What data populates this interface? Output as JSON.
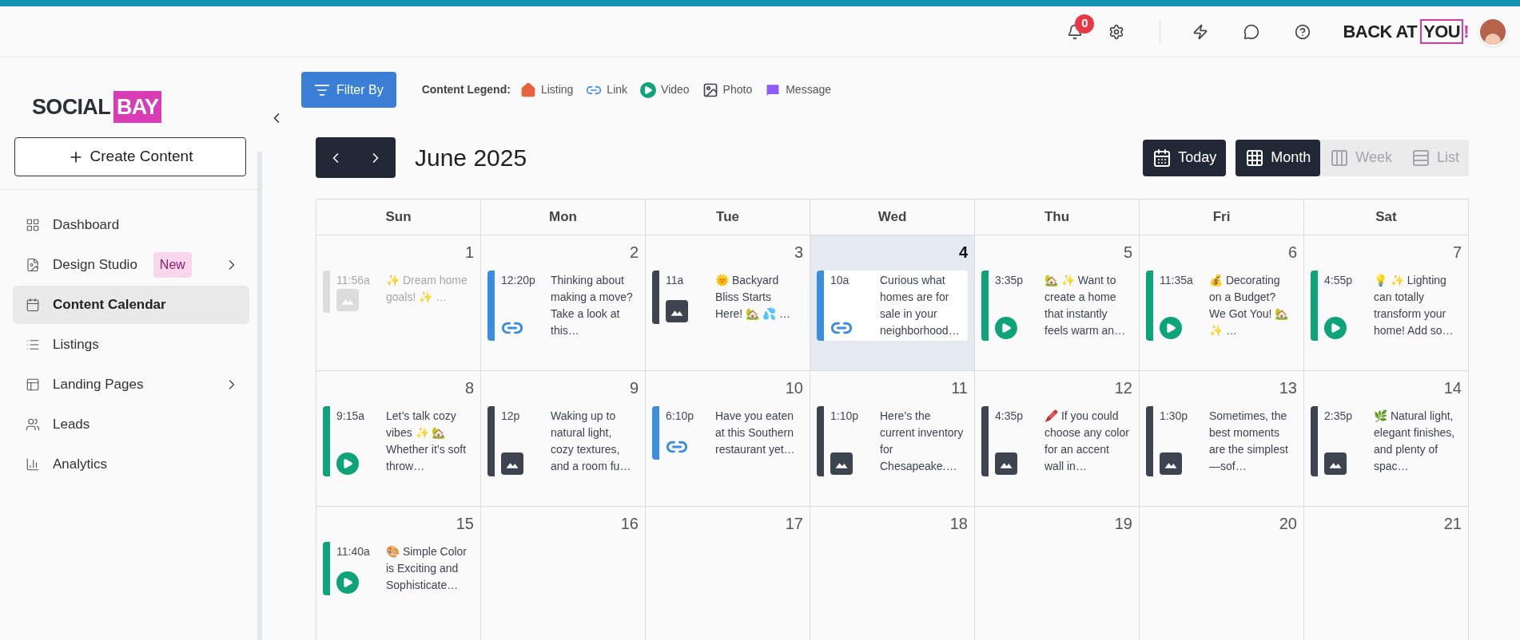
{
  "header": {
    "notification_count": "0",
    "brand": {
      "left": "BACK AT",
      "right": "YOU",
      "mark": "!"
    }
  },
  "sidebar": {
    "logo": {
      "left": "SOCIAL",
      "right": "BAY"
    },
    "create_button": "Create Content",
    "items": [
      {
        "label": "Dashboard",
        "kind": "dashboard",
        "selected": false,
        "submenu": false
      },
      {
        "label": "Design Studio",
        "kind": "design",
        "selected": false,
        "submenu": true,
        "badge": "New"
      },
      {
        "label": "Content Calendar",
        "kind": "calendar",
        "selected": true,
        "submenu": false
      },
      {
        "label": "Listings",
        "kind": "listings",
        "selected": false,
        "submenu": false
      },
      {
        "label": "Landing Pages",
        "kind": "landing",
        "selected": false,
        "submenu": true
      },
      {
        "label": "Leads",
        "kind": "leads",
        "selected": false,
        "submenu": false
      },
      {
        "label": "Analytics",
        "kind": "analytics",
        "selected": false,
        "submenu": false
      }
    ]
  },
  "filter_button": "Filter By",
  "legend": {
    "title": "Content Legend:",
    "items": [
      {
        "label": "Listing",
        "kind": "listing"
      },
      {
        "label": "Link",
        "kind": "link"
      },
      {
        "label": "Video",
        "kind": "video"
      },
      {
        "label": "Photo",
        "kind": "photo"
      },
      {
        "label": "Message",
        "kind": "message"
      }
    ]
  },
  "calendar": {
    "title": "June 2025",
    "today_button": "Today",
    "views": [
      {
        "label": "Month",
        "kind": "month",
        "selected": true
      },
      {
        "label": "Week",
        "kind": "week",
        "selected": false
      },
      {
        "label": "List",
        "kind": "list",
        "selected": false
      }
    ],
    "weekdays": [
      "Sun",
      "Mon",
      "Tue",
      "Wed",
      "Thu",
      "Fri",
      "Sat"
    ],
    "days": [
      {
        "number": "1",
        "today": false,
        "events": [
          {
            "time": "11:56a",
            "text": "✨ Dream home goals! ✨ …",
            "kind": "photo",
            "faded": true
          }
        ]
      },
      {
        "number": "2",
        "today": false,
        "events": [
          {
            "time": "12:20p",
            "text": "Thinking about making a move? Take a look at this…",
            "kind": "link",
            "faded": false
          }
        ]
      },
      {
        "number": "3",
        "today": false,
        "events": [
          {
            "time": "11a",
            "text": "🌞 Backyard Bliss Starts Here! 🏡 💦 …",
            "kind": "photo",
            "faded": false
          }
        ]
      },
      {
        "number": "4",
        "today": true,
        "events": [
          {
            "time": "10a",
            "text": "Curious what homes are for sale in your neighborhood…",
            "kind": "link",
            "faded": false
          }
        ]
      },
      {
        "number": "5",
        "today": false,
        "events": [
          {
            "time": "3:35p",
            "text": "🏡 ✨ Want to create a home that instantly feels warm an…",
            "kind": "video",
            "faded": false
          }
        ]
      },
      {
        "number": "6",
        "today": false,
        "events": [
          {
            "time": "11:35a",
            "text": "💰 Decorating on a Budget? We Got You! 🏡 ✨ …",
            "kind": "video",
            "faded": false
          }
        ]
      },
      {
        "number": "7",
        "today": false,
        "events": [
          {
            "time": "4:55p",
            "text": "💡 ✨ Lighting can totally transform your home! Add so…",
            "kind": "video",
            "faded": false
          }
        ]
      },
      {
        "number": "8",
        "today": false,
        "events": [
          {
            "time": "9:15a",
            "text": "Let’s talk cozy vibes ✨ 🏡 Whether it’s soft throw…",
            "kind": "video",
            "faded": false
          }
        ]
      },
      {
        "number": "9",
        "today": false,
        "events": [
          {
            "time": "12p",
            "text": "Waking up to natural light, cozy textures, and a room fu…",
            "kind": "photo",
            "faded": false
          }
        ]
      },
      {
        "number": "10",
        "today": false,
        "events": [
          {
            "time": "6:10p",
            "text": "Have you eaten at this Southern restaurant yet…",
            "kind": "link",
            "faded": false
          }
        ]
      },
      {
        "number": "11",
        "today": false,
        "events": [
          {
            "time": "1:10p",
            "text": "Here’s the current inventory for Chesapeake.…",
            "kind": "photo",
            "faded": false
          }
        ]
      },
      {
        "number": "12",
        "today": false,
        "events": [
          {
            "time": "4:35p",
            "text": "🖍️ If you could choose any color for an accent wall in…",
            "kind": "photo",
            "faded": false
          }
        ]
      },
      {
        "number": "13",
        "today": false,
        "events": [
          {
            "time": "1:30p",
            "text": "Sometimes, the best moments are the simplest—sof…",
            "kind": "photo",
            "faded": false
          }
        ]
      },
      {
        "number": "14",
        "today": false,
        "events": [
          {
            "time": "2:35p",
            "text": "🌿 Natural light, elegant finishes, and plenty of spac…",
            "kind": "photo",
            "faded": false
          }
        ]
      },
      {
        "number": "15",
        "today": false,
        "events": [
          {
            "time": "11:40a",
            "text": "🎨 Simple Color is Exciting and Sophisticate…",
            "kind": "video",
            "faded": false
          }
        ]
      },
      {
        "number": "16",
        "today": false
      },
      {
        "number": "17",
        "today": false
      },
      {
        "number": "18",
        "today": false
      },
      {
        "number": "19",
        "today": false
      },
      {
        "number": "20",
        "today": false
      },
      {
        "number": "21",
        "today": false
      }
    ]
  }
}
